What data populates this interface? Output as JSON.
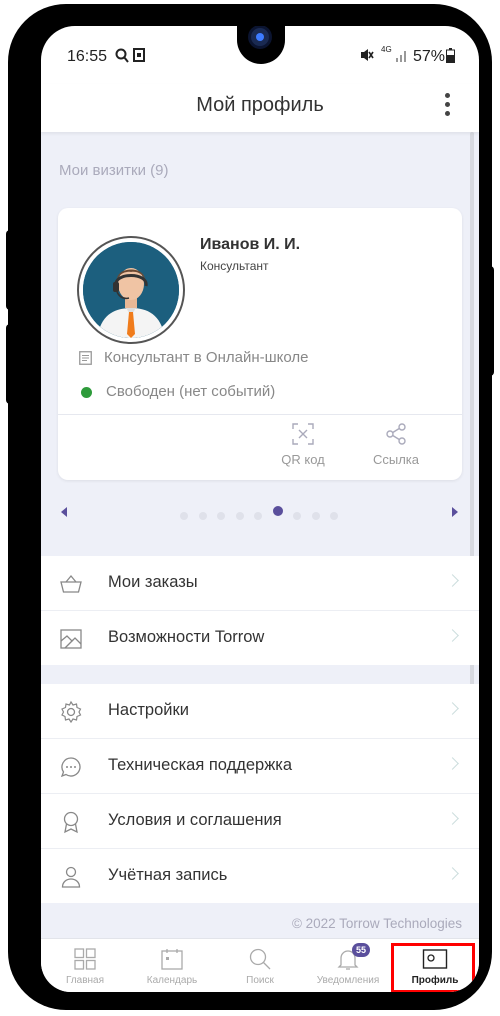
{
  "status_bar": {
    "time": "16:55",
    "network": "4G",
    "battery": "57%"
  },
  "header": {
    "title": "Мой профиль"
  },
  "cards": {
    "section_title": "Мои визитки (9)",
    "card": {
      "name": "Иванов И. И.",
      "role": "Консультант",
      "organization": "Консультант в Онлайн-школе",
      "status": "Свободен (нет событий)",
      "actions": [
        {
          "label": "QR код",
          "icon": "qr-code-icon"
        },
        {
          "label": "Ссылка",
          "icon": "share-icon"
        }
      ]
    },
    "pager": {
      "total": 9,
      "active_index": 5
    }
  },
  "menu": {
    "group1": [
      {
        "label": "Мои заказы",
        "icon": "basket-icon"
      },
      {
        "label": "Возможности Torrow",
        "icon": "features-icon"
      }
    ],
    "group2": [
      {
        "label": "Настройки",
        "icon": "gear-icon"
      },
      {
        "label": "Техническая поддержка",
        "icon": "chat-icon"
      },
      {
        "label": "Условия и соглашения",
        "icon": "award-icon"
      },
      {
        "label": "Учётная запись",
        "icon": "user-icon"
      }
    ]
  },
  "footer": {
    "copyright": "© 2022 Torrow Technologies"
  },
  "bottom_nav": {
    "tabs": [
      {
        "label": "Главная",
        "icon": "grid-icon"
      },
      {
        "label": "Календарь",
        "icon": "calendar-icon"
      },
      {
        "label": "Поиск",
        "icon": "search-icon"
      },
      {
        "label": "Уведомления",
        "icon": "bell-icon",
        "badge": "55"
      },
      {
        "label": "Профиль",
        "icon": "profile-card-icon",
        "active": true
      }
    ]
  },
  "colors": {
    "accent": "#5a4f9c",
    "status_free": "#2e9b3b",
    "highlight": "#ff0000"
  }
}
